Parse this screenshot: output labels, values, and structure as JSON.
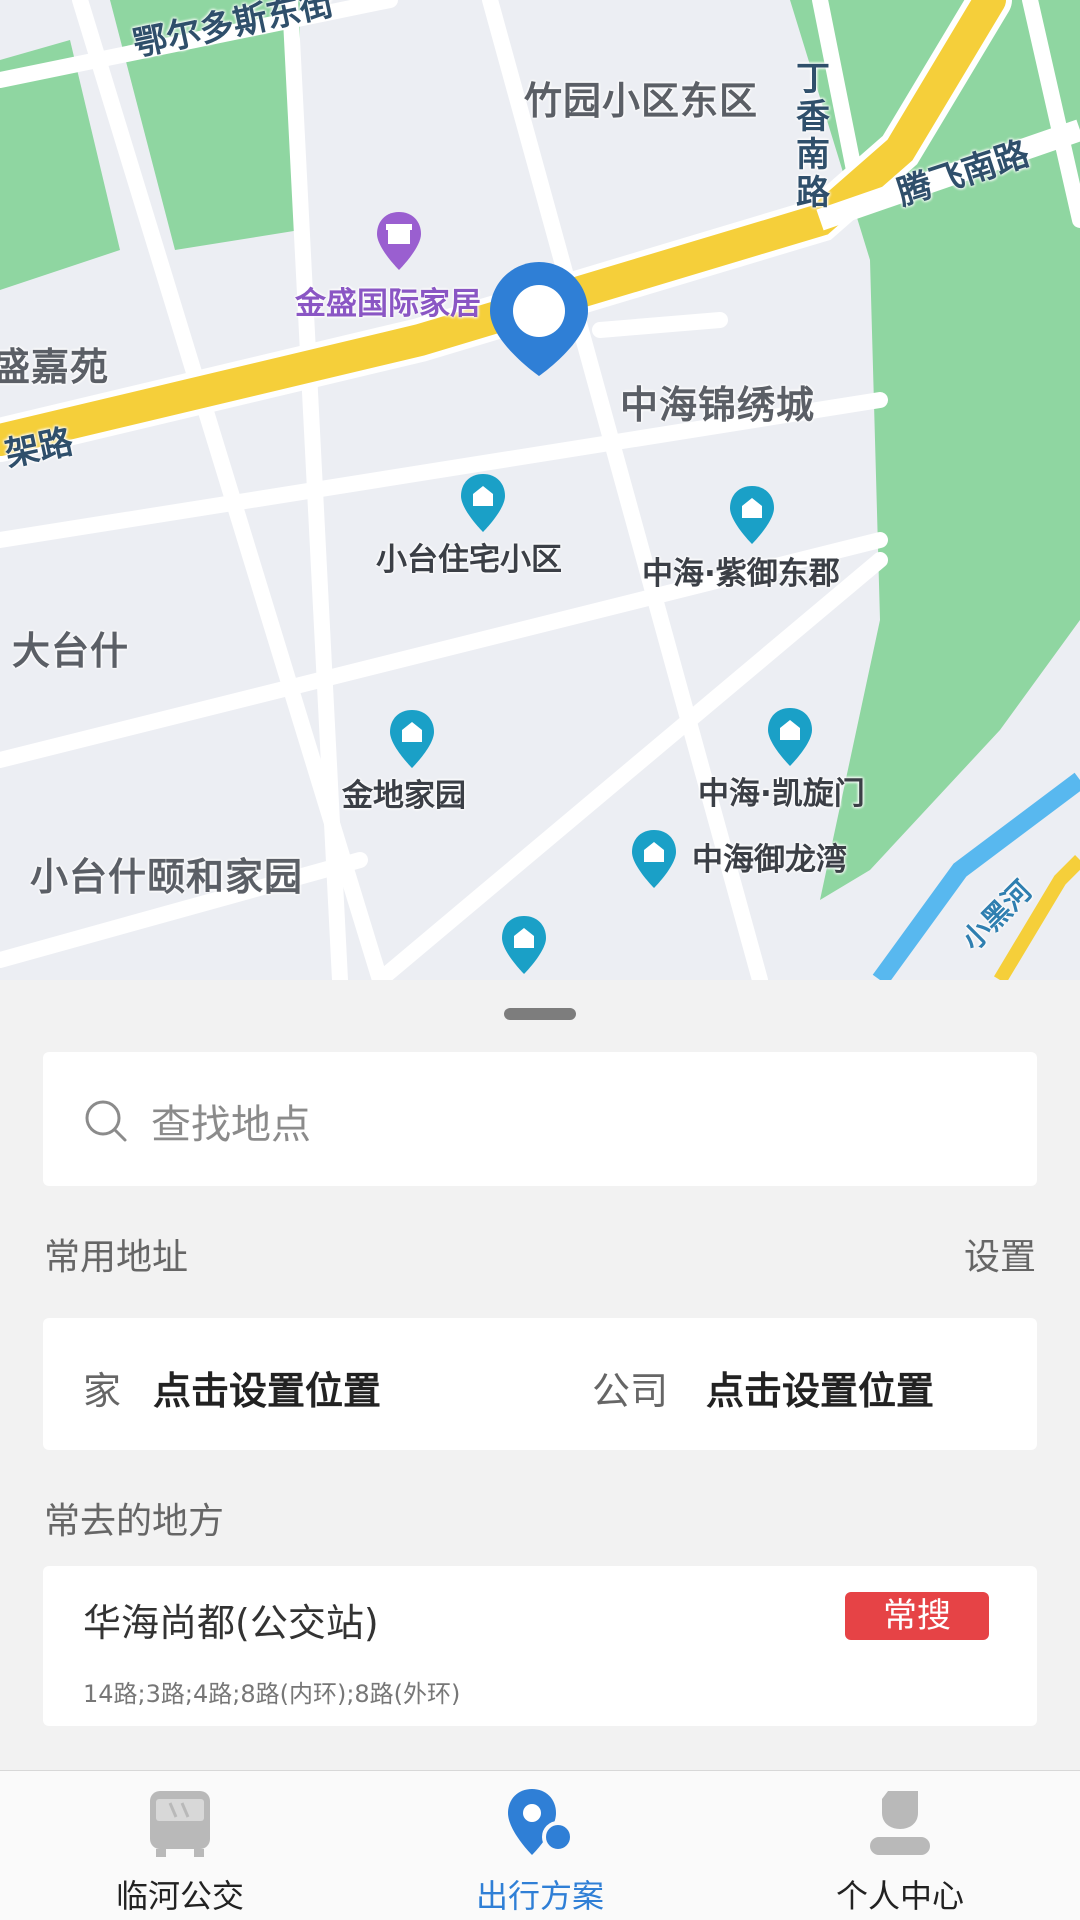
{
  "map": {
    "labels": {
      "ordos_east_street": "鄂尔多斯东街",
      "zhuyuan_east": "竹园小区东区",
      "dingxiang_south_road": "丁香南路",
      "tengfei_south_road": "腾飞南路",
      "jinsheng_home": "金盛国际家居",
      "jiayuan_partial": "盛嘉苑",
      "jialu_partial": "架路",
      "zhonghai_jinxiu": "中海锦绣城",
      "xiaotai_residential": "小台住宅小区",
      "zhonghai_ziyu": "中海·紫御东郡",
      "datai_shi": "大台什",
      "jindi_jiayuan": "金地家园",
      "zhonghai_kaixuan": "中海·凯旋门",
      "zhonghai_yulong": "中海御龙湾",
      "xiaotaishi_yihe": "小台什颐和家园",
      "xiaohei_river": "小黑河"
    },
    "colors": {
      "background": "#eceef3",
      "green": "#8fd6a1",
      "main_road": "#f5cf3a",
      "river": "#58b8ef",
      "pin": "#2f7fd6",
      "poi": "#1aa0c7"
    }
  },
  "search": {
    "placeholder": "查找地点",
    "icon": "search-icon"
  },
  "common_addresses": {
    "title": "常用地址",
    "settings_label": "设置",
    "home_key": "家",
    "home_value": "点击设置位置",
    "work_key": "公司",
    "work_value": "点击设置位置"
  },
  "frequent_places": {
    "title": "常去的地方",
    "items": [
      {
        "name": "华海尚都(公交站)",
        "badge": "常搜",
        "lines": "14路;3路;4路;8路(内环);8路(外环)"
      }
    ]
  },
  "tabs": [
    {
      "label": "临河公交",
      "icon": "bus-icon",
      "active": false
    },
    {
      "label": "出行方案",
      "icon": "location-pin-icon",
      "active": true
    },
    {
      "label": "个人中心",
      "icon": "person-icon",
      "active": false
    }
  ]
}
